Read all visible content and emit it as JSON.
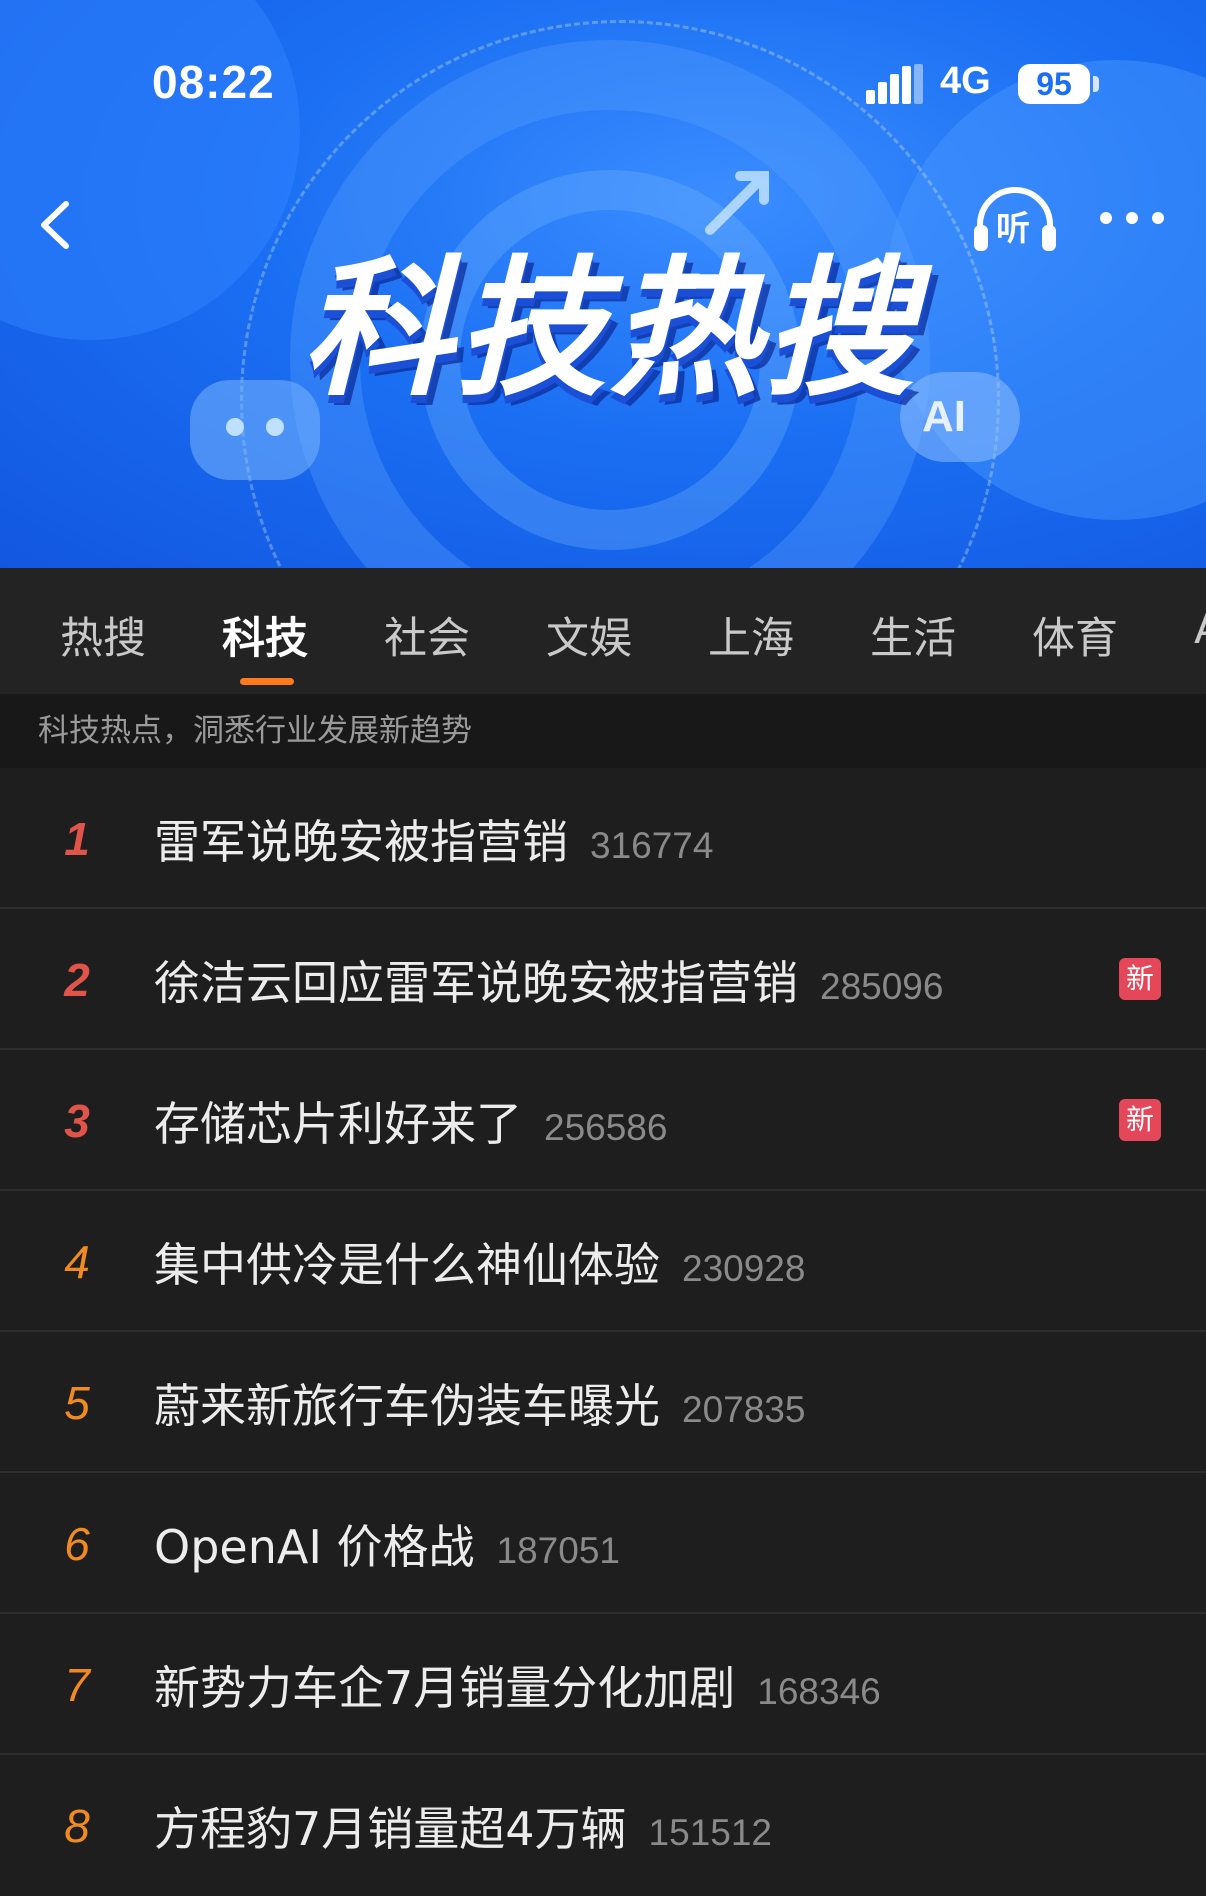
{
  "status": {
    "time": "08:22",
    "network": "4G",
    "battery": "95"
  },
  "header": {
    "listen_label": "听",
    "hero_title": "科技热搜",
    "decor_ai": "AI"
  },
  "tabs": [
    {
      "label": "热搜"
    },
    {
      "label": "科技",
      "active": true
    },
    {
      "label": "社会"
    },
    {
      "label": "文娱"
    },
    {
      "label": "上海"
    },
    {
      "label": "生活"
    },
    {
      "label": "体育"
    },
    {
      "label": "A"
    }
  ],
  "subheader": "科技热点，洞悉行业发展新趋势",
  "badge_new": "新",
  "items": [
    {
      "rank": "1",
      "title": "雷军说晚安被指营销",
      "count": "316774",
      "badge": ""
    },
    {
      "rank": "2",
      "title": "徐洁云回应雷军说晚安被指营销",
      "count": "285096",
      "badge": "新"
    },
    {
      "rank": "3",
      "title": "存储芯片利好来了",
      "count": "256586",
      "badge": "新"
    },
    {
      "rank": "4",
      "title": "集中供冷是什么神仙体验",
      "count": "230928",
      "badge": ""
    },
    {
      "rank": "5",
      "title": "蔚来新旅行车伪装车曝光",
      "count": "207835",
      "badge": ""
    },
    {
      "rank": "6",
      "title": "OpenAI 价格战",
      "count": "187051",
      "badge": ""
    },
    {
      "rank": "7",
      "title": "新势力车企7月销量分化加剧",
      "count": "168346",
      "badge": ""
    },
    {
      "rank": "8",
      "title": "方程豹7月销量超4万辆",
      "count": "151512",
      "badge": ""
    }
  ]
}
